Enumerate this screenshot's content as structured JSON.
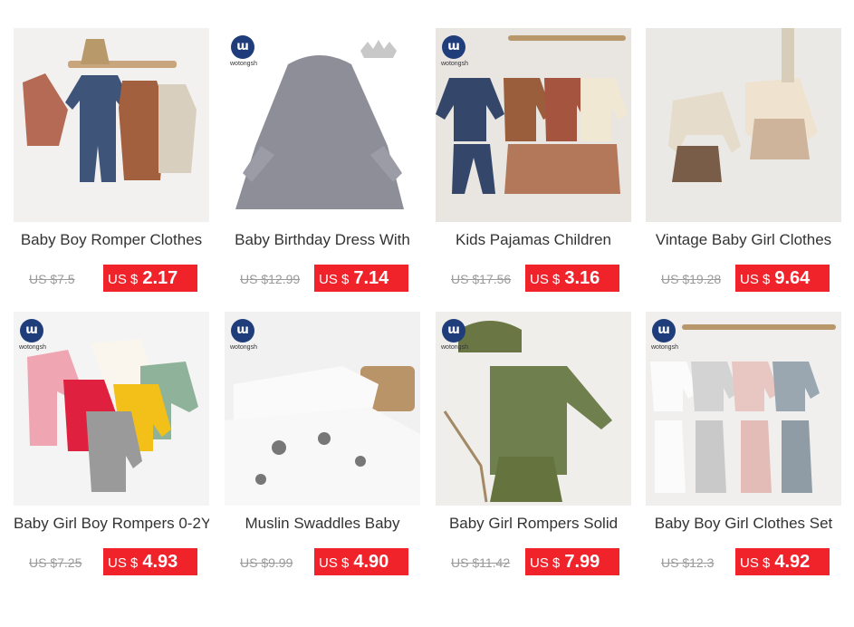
{
  "brand_logo": {
    "mark": "ɯ",
    "text": "wotongsh"
  },
  "products": [
    {
      "title": "Baby Boy Romper Clothes",
      "old_price": "US $7.5",
      "currency": "US $",
      "price": "2.17",
      "logo": false
    },
    {
      "title": "Baby Birthday Dress With",
      "old_price": "US $12.99",
      "currency": "US $",
      "price": "7.14",
      "logo": true
    },
    {
      "title": "Kids Pajamas Children",
      "old_price": "US $17.56",
      "currency": "US $",
      "price": "3.16",
      "logo": true
    },
    {
      "title": "Vintage Baby Girl Clothes",
      "old_price": "US $19.28",
      "currency": "US $",
      "price": "9.64",
      "logo": false
    },
    {
      "title": "Baby Girl Boy Rompers 0-2Y",
      "old_price": "US $7.25",
      "currency": "US $",
      "price": "4.93",
      "logo": true
    },
    {
      "title": "Muslin Swaddles Baby",
      "old_price": "US $9.99",
      "currency": "US $",
      "price": "4.90",
      "logo": true
    },
    {
      "title": "Baby Girl Rompers Solid",
      "old_price": "US $11.42",
      "currency": "US $",
      "price": "7.99",
      "logo": true
    },
    {
      "title": "Baby Boy Girl Clothes Set",
      "old_price": "US $12.3",
      "currency": "US $",
      "price": "4.92",
      "logo": true
    }
  ],
  "colors": {
    "sale_badge": "#f0232b",
    "old_price": "#9a9a9a",
    "title": "#333333"
  }
}
